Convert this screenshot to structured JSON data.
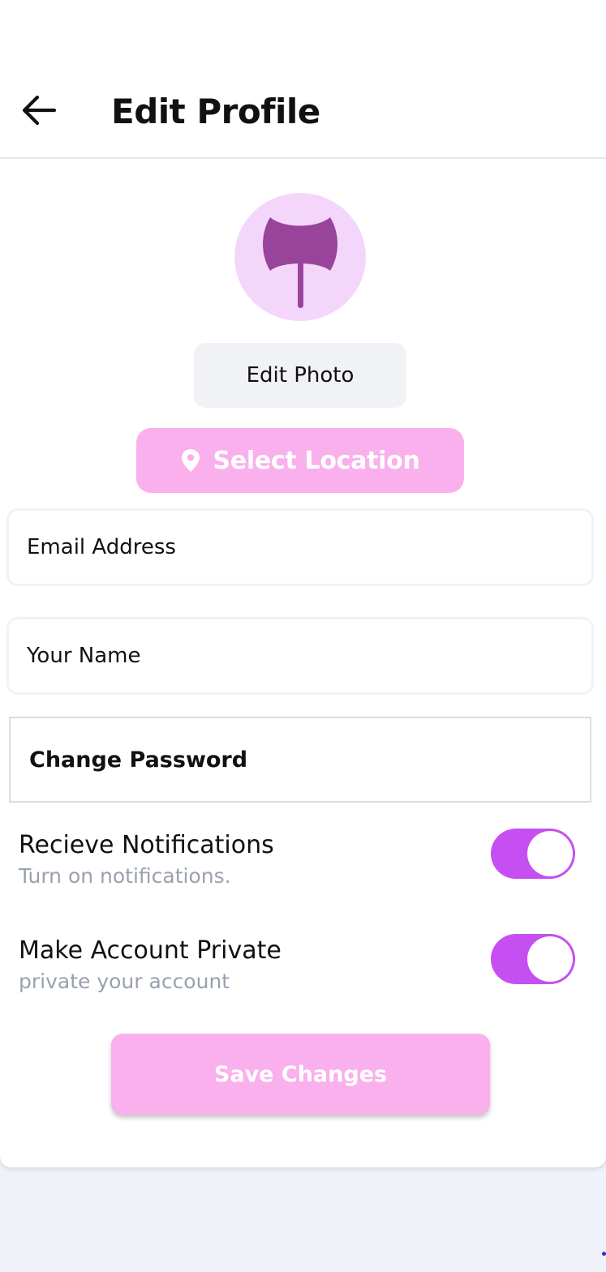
{
  "header": {
    "title": "Edit Profile",
    "back_icon": "arrow-left-icon"
  },
  "profile": {
    "avatar_icon": "axe-icon",
    "edit_photo_label": "Edit Photo",
    "location_icon": "map-pin-icon",
    "select_location_label": "Select Location"
  },
  "form": {
    "email_placeholder": "Email Address",
    "email_value": "",
    "name_placeholder": "Your Name",
    "name_value": "",
    "change_password_label": "Change Password"
  },
  "settings": [
    {
      "title": "Recieve Notifications",
      "subtitle": "Turn on notifications.",
      "enabled": true
    },
    {
      "title": "Make Account Private",
      "subtitle": "private your account",
      "enabled": true
    }
  ],
  "save_label": "Save Changes",
  "colors": {
    "accent": "#c64ff2",
    "button_pink": "#f9b0ec",
    "avatar_bg": "#f5d6fb",
    "avatar_icon": "#97449a",
    "muted_text": "#9aa1ad"
  }
}
